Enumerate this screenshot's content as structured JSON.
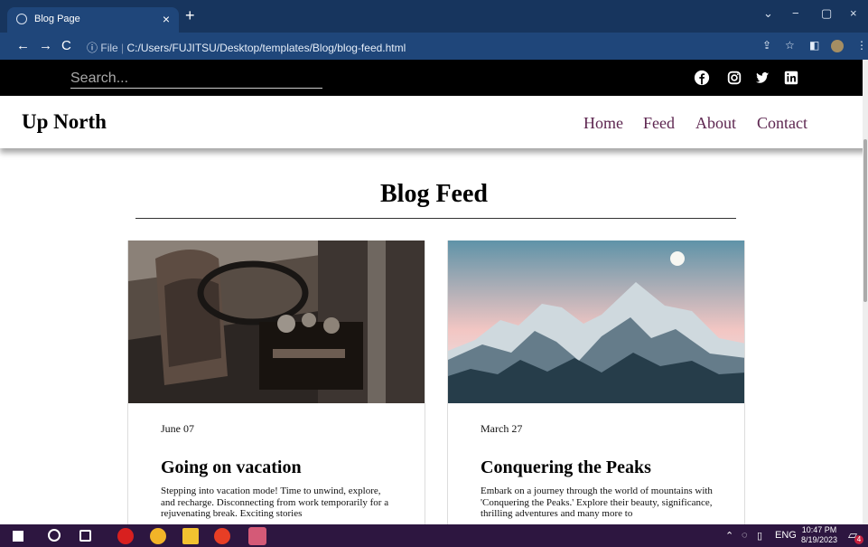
{
  "browser": {
    "tab_title": "Blog Page",
    "address": "C:/Users/FUJITSU/Desktop/templates/Blog/blog-feed.html",
    "file_label": "File",
    "new_tab_label": "+"
  },
  "site": {
    "search_placeholder": "Search...",
    "brand": "Up North",
    "nav": [
      "Home",
      "Feed",
      "About",
      "Contact"
    ],
    "social_icons": [
      "facebook-icon",
      "instagram-icon",
      "twitter-icon",
      "linkedin-icon"
    ],
    "feed_title": "Blog Feed",
    "posts": [
      {
        "date": "June 07",
        "title": "Going on vacation",
        "excerpt": "Stepping into vacation mode! Time to unwind, explore, and recharge. Disconnecting from work temporarily for a rejuvenating break. Exciting stories"
      },
      {
        "date": "March 27",
        "title": "Conquering the Peaks",
        "excerpt": "Embark on a journey through the world of mountains with 'Conquering the Peaks.' Explore their beauty, significance, thrilling adventures and many more to"
      }
    ]
  },
  "taskbar": {
    "language": "ENG",
    "time": "10:47 PM",
    "date": "8/19/2023",
    "notification_count": "4"
  },
  "colors": {
    "browser_tabs": "#17355e",
    "browser_address": "#1f467a",
    "site_topbar": "#000000",
    "nav_link": "#5d2650",
    "taskbar": "#2d1640"
  }
}
